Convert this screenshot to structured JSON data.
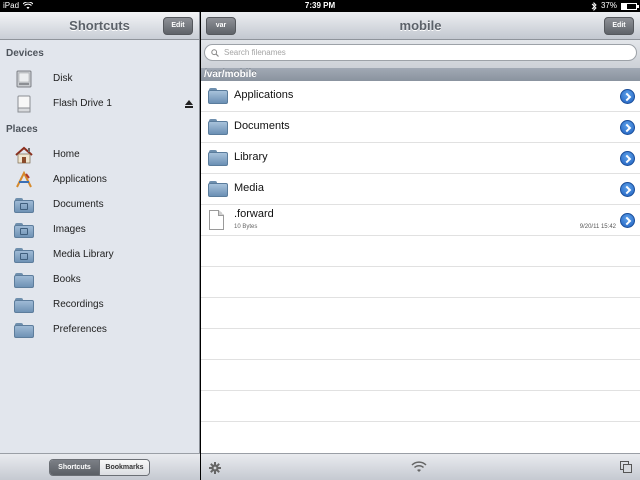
{
  "status_bar": {
    "device": "iPad",
    "time": "7:39 PM",
    "battery": "37%",
    "battery_level": 0.37
  },
  "sidebar": {
    "title": "Shortcuts",
    "edit_label": "Edit",
    "sections": {
      "devices": "Devices",
      "places": "Places"
    },
    "devices": [
      {
        "label": "Disk",
        "icon": "disk-icon"
      },
      {
        "label": "Flash Drive 1",
        "icon": "flash-drive-icon"
      }
    ],
    "places": [
      {
        "label": "Home",
        "icon": "home-icon"
      },
      {
        "label": "Applications",
        "icon": "applications-icon"
      },
      {
        "label": "Documents",
        "icon": "documents-folder-icon"
      },
      {
        "label": "Images",
        "icon": "images-folder-icon"
      },
      {
        "label": "Media Library",
        "icon": "media-library-folder-icon"
      },
      {
        "label": "Books",
        "icon": "folder-icon"
      },
      {
        "label": "Recordings",
        "icon": "folder-icon"
      },
      {
        "label": "Preferences",
        "icon": "folder-icon"
      }
    ],
    "footer": {
      "tab_active": "Shortcuts",
      "tab_inactive": "Bookmarks"
    }
  },
  "main": {
    "back_label": "var",
    "title": "mobile",
    "edit_label": "Edit",
    "search": {
      "placeholder": "Search filenames",
      "value": ""
    },
    "path": "/var/mobile",
    "items": [
      {
        "name": "Applications",
        "type": "folder"
      },
      {
        "name": "Documents",
        "type": "folder"
      },
      {
        "name": "Library",
        "type": "folder"
      },
      {
        "name": "Media",
        "type": "folder"
      },
      {
        "name": ".forward",
        "type": "file",
        "size": "10 Bytes",
        "date": "9/20/11 15:42"
      }
    ]
  },
  "colors": {
    "accent": "#2f6fd0",
    "path_bar": "#939ba6",
    "sidebar_bg": "#e2e6ed"
  }
}
